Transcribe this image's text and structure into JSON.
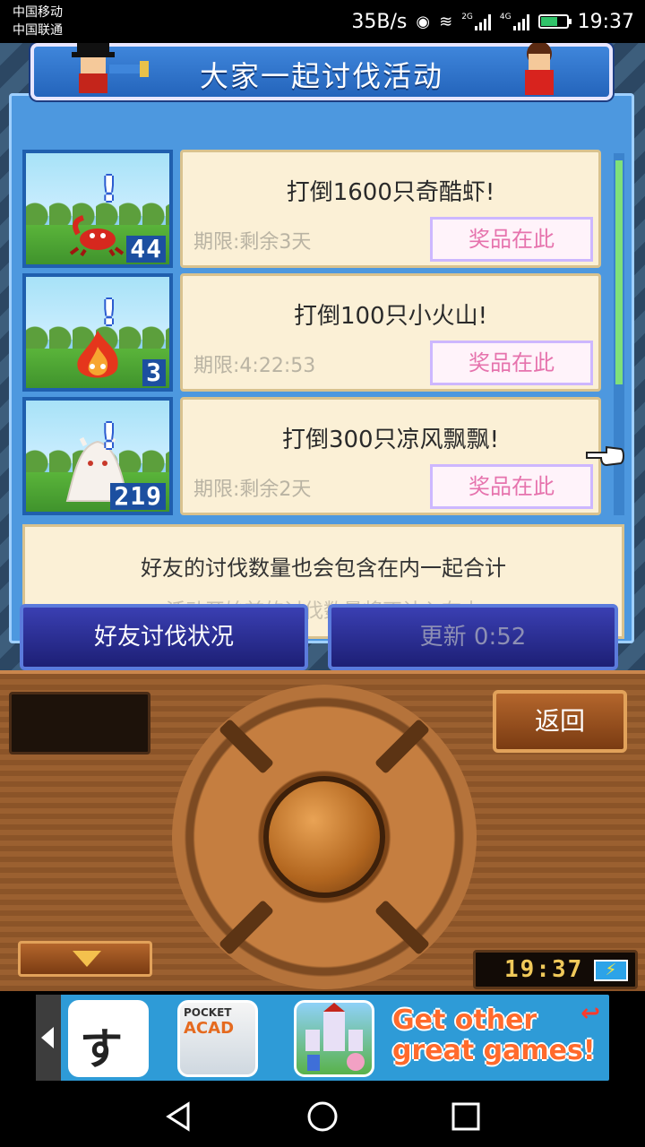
{
  "status_bar": {
    "carrier1": "中国移动",
    "carrier2": "中国联通",
    "speed": "35B/s",
    "network1": "2G",
    "network2": "4G",
    "time": "19:37"
  },
  "event": {
    "title": "大家一起讨伐活动",
    "quests": [
      {
        "task": "打倒1600只奇酷虾!",
        "deadline": "期限:剩余3天",
        "prize": "奖品在此",
        "count": "44",
        "monster": "scorpion-icon"
      },
      {
        "task": "打倒100只小火山!",
        "deadline": "期限:4:22:53",
        "prize": "奖品在此",
        "count": "3",
        "monster": "flame-icon"
      },
      {
        "task": "打倒300只凉风飘飘!",
        "deadline": "期限:剩余2天",
        "prize": "奖品在此",
        "count": "219",
        "monster": "ghost-icon"
      }
    ],
    "info_main": "好友的讨伐数量也会包含在内一起合计",
    "info_sub": "活动开始前的讨伐数量将不计入在内",
    "friends_button": "好友讨伐状况",
    "update_button": "更新 0:52"
  },
  "console": {
    "back_button": "返回",
    "clock": "19:37"
  },
  "ad": {
    "line1": "Get other",
    "line2": "great games!",
    "app2_title_small": "POCKET",
    "app2_title_big": "ACAD",
    "app1_glyph": "すし"
  },
  "colors": {
    "panel_blue": "#4d98df",
    "card_cream": "#fbf0d6",
    "prize_pink": "#e673ad",
    "button_navy": "#1d1f75",
    "wood": "#8b5428"
  }
}
